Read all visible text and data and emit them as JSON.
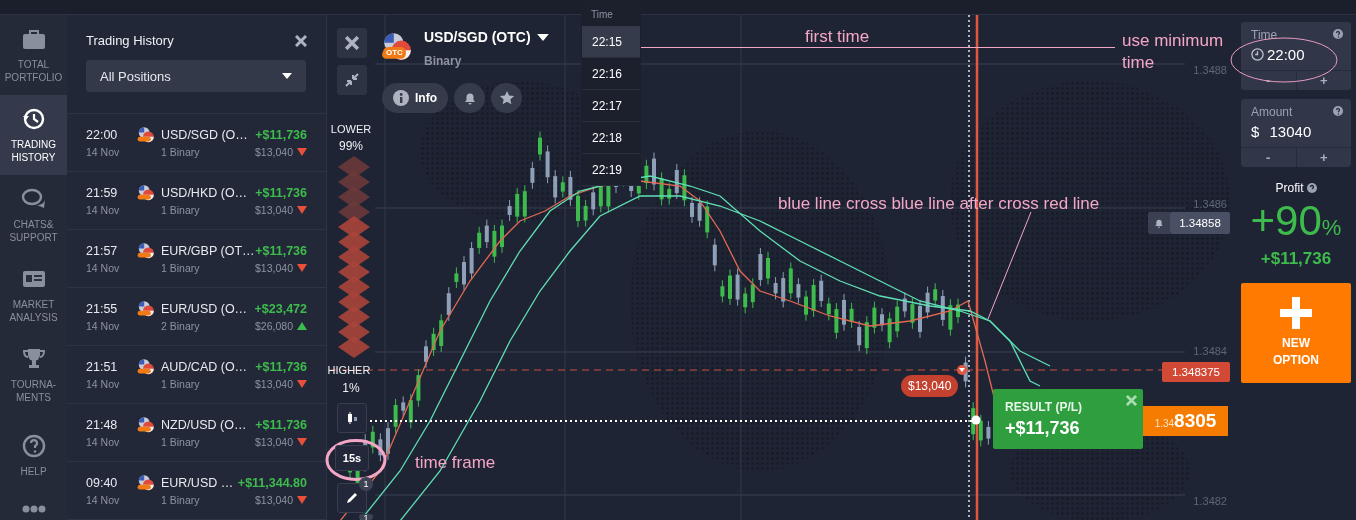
{
  "nav": {
    "items": [
      {
        "kind": "portfolio",
        "label": "TOTAL\nPORTFOLIO",
        "selected": false
      },
      {
        "kind": "history",
        "label": "TRADING\nHISTORY",
        "selected": true
      },
      {
        "kind": "chat",
        "label": "CHATS&\nSUPPORT",
        "selected": false
      },
      {
        "kind": "analysis",
        "label": "MARKET\nANALYSIS",
        "selected": false
      },
      {
        "kind": "trophy",
        "label": "TOURNA-\nMENTS",
        "selected": false
      },
      {
        "kind": "help",
        "label": "HELP",
        "selected": false
      }
    ]
  },
  "history": {
    "title": "Trading History",
    "filter": "All Positions",
    "rows": [
      {
        "time": "22:00",
        "date": "14 Nov",
        "asset": "USD/SGD (O…",
        "count": "1 Binary",
        "profit": "+$11,736",
        "amount": "$13,040",
        "rising": false
      },
      {
        "time": "21:59",
        "date": "14 Nov",
        "asset": "USD/HKD (O…",
        "count": "1 Binary",
        "profit": "+$11,736",
        "amount": "$13,040",
        "rising": false
      },
      {
        "time": "21:57",
        "date": "14 Nov",
        "asset": "EUR/GBP (OT…",
        "count": "1 Binary",
        "profit": "+$11,736",
        "amount": "$13,040",
        "rising": false
      },
      {
        "time": "21:55",
        "date": "14 Nov",
        "asset": "EUR/USD (O…",
        "count": "2 Binary",
        "profit": "+$23,472",
        "amount": "$26,080",
        "rising": true
      },
      {
        "time": "21:51",
        "date": "14 Nov",
        "asset": "AUD/CAD (O…",
        "count": "1 Binary",
        "profit": "+$11,736",
        "amount": "$13,040",
        "rising": false
      },
      {
        "time": "21:48",
        "date": "14 Nov",
        "asset": "NZD/USD (O…",
        "count": "1 Binary",
        "profit": "+$11,736",
        "amount": "$13,040",
        "rising": false
      },
      {
        "time": "09:40",
        "date": "14 Nov",
        "asset": "EUR/USD …",
        "count": "1 Binary",
        "profit": "+$11,344.80",
        "amount": "$13,040",
        "rising": false
      }
    ]
  },
  "chart": {
    "asset": "USD/SGD (OTC)",
    "badge": "OTC",
    "type": "Binary",
    "info": "Info",
    "time_menu": {
      "title": "Time",
      "options": [
        {
          "label": "22:15",
          "selected": true
        },
        {
          "label": "22:16",
          "selected": false
        },
        {
          "label": "22:17",
          "selected": false
        },
        {
          "label": "22:18",
          "selected": false
        },
        {
          "label": "22:19",
          "selected": false
        }
      ]
    },
    "lower": {
      "label": "LOWER",
      "percent": "99%"
    },
    "higher": {
      "label": "HIGHER",
      "percent": "1%"
    },
    "timeframe": "15s",
    "tool_badges": [
      "1",
      "1"
    ],
    "price_axis": [
      "1.3488",
      "1.3486",
      "1.3484",
      "1.3482"
    ],
    "alert_price": "1.34858",
    "strike_price": "1.348375",
    "current_price": {
      "lead": "1.34",
      "tail": "8305"
    },
    "investment": "$13,040",
    "result": {
      "label": "RESULT (P/L)",
      "value": "+$11,736"
    },
    "annotations": [
      {
        "text": "first time"
      },
      {
        "text": "use minimum"
      },
      {
        "text": "time"
      },
      {
        "text": "blue line cross blue line after cross red line"
      },
      {
        "text": "time frame"
      }
    ]
  },
  "trade": {
    "time": {
      "label": "Time",
      "value": "22:00",
      "steppers": [
        "-",
        "+"
      ]
    },
    "amount": {
      "label": "Amount",
      "currency": "$",
      "value": "13040",
      "steppers": [
        "-",
        "+"
      ]
    },
    "profit": {
      "label": "Profit",
      "percent": "+90",
      "unit": "%",
      "value": "+$11,736"
    },
    "new_option": "NEW\nOPTION"
  }
}
